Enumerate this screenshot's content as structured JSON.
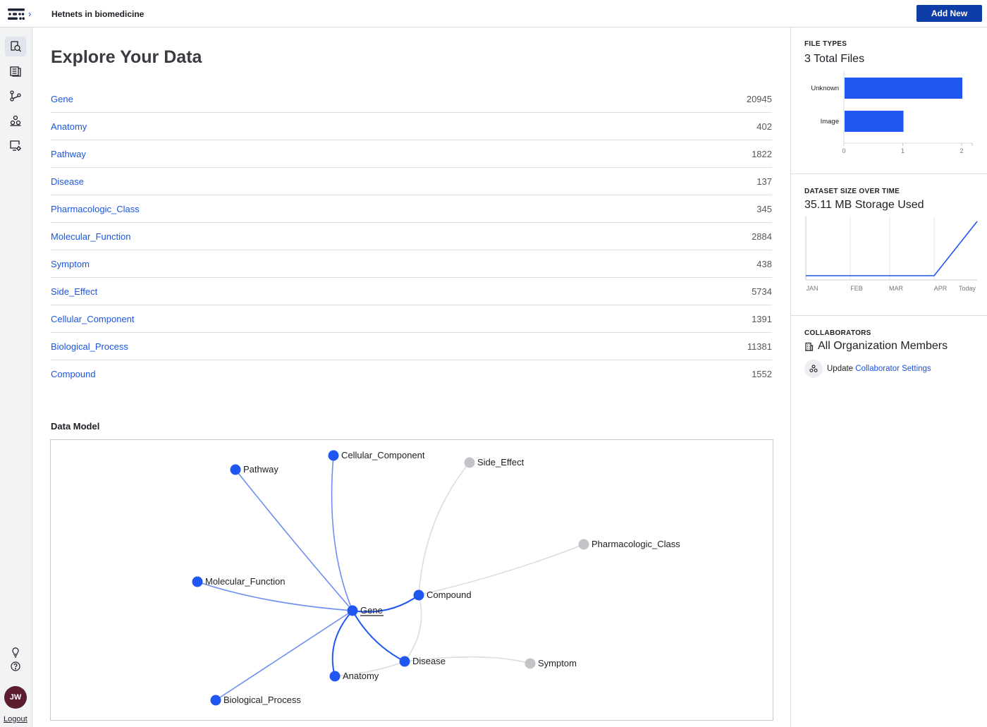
{
  "topbar": {
    "project_title": "Hetnets in biomedicine",
    "add_new_label": "Add New"
  },
  "sidebar": {
    "items": [
      {
        "icon": "explore-icon",
        "active": true
      },
      {
        "icon": "records-icon",
        "active": false
      },
      {
        "icon": "graph-icon",
        "active": false
      },
      {
        "icon": "collaborators-icon",
        "active": false
      },
      {
        "icon": "settings-icon",
        "active": false
      }
    ],
    "bottom": {
      "tips_icon": "lightbulb-icon",
      "help_icon": "help-icon",
      "avatar_initials": "JW",
      "logout_label": "Logout"
    }
  },
  "main": {
    "title": "Explore Your Data",
    "types": [
      {
        "name": "Gene",
        "count": "20945"
      },
      {
        "name": "Anatomy",
        "count": "402"
      },
      {
        "name": "Pathway",
        "count": "1822"
      },
      {
        "name": "Disease",
        "count": "137"
      },
      {
        "name": "Pharmacologic_Class",
        "count": "345"
      },
      {
        "name": "Molecular_Function",
        "count": "2884"
      },
      {
        "name": "Symptom",
        "count": "438"
      },
      {
        "name": "Side_Effect",
        "count": "5734"
      },
      {
        "name": "Cellular_Component",
        "count": "1391"
      },
      {
        "name": "Biological_Process",
        "count": "11381"
      },
      {
        "name": "Compound",
        "count": "1552"
      }
    ],
    "data_model": {
      "title": "Data Model",
      "nodes": [
        {
          "id": "Gene",
          "label": "Gene",
          "status": "active",
          "underlined": true
        },
        {
          "id": "Pathway",
          "label": "Pathway",
          "status": "active"
        },
        {
          "id": "Cellular_Component",
          "label": "Cellular_Component",
          "status": "active"
        },
        {
          "id": "Side_Effect",
          "label": "Side_Effect",
          "status": "inactive"
        },
        {
          "id": "Pharmacologic_Class",
          "label": "Pharmacologic_Class",
          "status": "inactive"
        },
        {
          "id": "Molecular_Function",
          "label": "Molecular_Function",
          "status": "active"
        },
        {
          "id": "Compound",
          "label": "Compound",
          "status": "active"
        },
        {
          "id": "Disease",
          "label": "Disease",
          "status": "active"
        },
        {
          "id": "Symptom",
          "label": "Symptom",
          "status": "inactive"
        },
        {
          "id": "Anatomy",
          "label": "Anatomy",
          "status": "active"
        },
        {
          "id": "Biological_Process",
          "label": "Biological_Process",
          "status": "active"
        }
      ],
      "edges": [
        {
          "from": "Gene",
          "to": "Pathway",
          "style": "light"
        },
        {
          "from": "Gene",
          "to": "Cellular_Component",
          "style": "light"
        },
        {
          "from": "Gene",
          "to": "Molecular_Function",
          "style": "light"
        },
        {
          "from": "Gene",
          "to": "Biological_Process",
          "style": "light"
        },
        {
          "from": "Gene",
          "to": "Compound",
          "style": "strong"
        },
        {
          "from": "Gene",
          "to": "Disease",
          "style": "strong"
        },
        {
          "from": "Gene",
          "to": "Anatomy",
          "style": "strong"
        },
        {
          "from": "Compound",
          "to": "Side_Effect",
          "style": "gray"
        },
        {
          "from": "Compound",
          "to": "Pharmacologic_Class",
          "style": "gray"
        },
        {
          "from": "Compound",
          "to": "Disease",
          "style": "gray"
        },
        {
          "from": "Disease",
          "to": "Symptom",
          "style": "gray"
        },
        {
          "from": "Disease",
          "to": "Anatomy",
          "style": "gray"
        }
      ]
    }
  },
  "right_panel": {
    "file_types": {
      "caption": "FILE TYPES",
      "headline": "3 Total Files"
    },
    "dataset_size": {
      "caption": "DATASET SIZE OVER TIME",
      "headline": "35.11 MB Storage Used"
    },
    "collaborators": {
      "caption": "COLLABORATORS",
      "headline": "All Organization Members",
      "update_prefix": "Update ",
      "update_link": "Collaborator Settings"
    }
  },
  "colors": {
    "accent": "#1a55e3",
    "primary_button": "#0f3da8",
    "node_active": "#1f57f0",
    "node_inactive": "#c3c4c7",
    "avatar": "#5c1d2e"
  },
  "chart_data": [
    {
      "type": "bar",
      "orientation": "horizontal",
      "categories": [
        "Unknown",
        "Image"
      ],
      "values": [
        2,
        1
      ],
      "xlim": [
        0,
        2
      ],
      "xticks": [
        "0",
        "1",
        "2"
      ],
      "color": "#1f57f0"
    },
    {
      "type": "line",
      "x": [
        "JAN",
        "FEB",
        "MAR",
        "APR",
        "Today"
      ],
      "values": [
        0,
        0,
        0,
        0,
        35.11
      ],
      "unit": "MB",
      "grid": true,
      "color": "#1f57f0"
    }
  ]
}
